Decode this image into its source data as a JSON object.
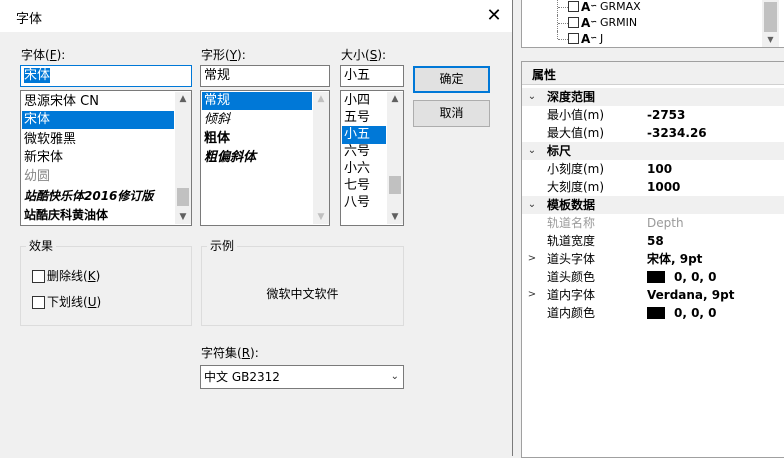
{
  "tree": {
    "items": [
      {
        "label": "GRMAX",
        "icon": "ruler-icon"
      },
      {
        "label": "GRMIN",
        "icon": "ruler-icon"
      },
      {
        "label": "J",
        "icon": "ruler-icon"
      }
    ]
  },
  "properties": {
    "title": "属性",
    "rows": [
      {
        "type": "category",
        "toggle": "⌄",
        "name": "深度范围"
      },
      {
        "type": "prop",
        "name": "最小值(m)",
        "value": "-2753"
      },
      {
        "type": "prop",
        "name": "最大值(m)",
        "value": "-3234.26"
      },
      {
        "type": "category",
        "toggle": "⌄",
        "name": "标尺"
      },
      {
        "type": "prop",
        "name": "小刻度(m)",
        "value": "100"
      },
      {
        "type": "prop",
        "name": "大刻度(m)",
        "value": "1000"
      },
      {
        "type": "category",
        "toggle": "⌄",
        "name": "模板数据"
      },
      {
        "type": "prop",
        "name": "轨道名称",
        "value": "Depth",
        "light": true
      },
      {
        "type": "prop",
        "name": "轨道宽度",
        "value": "58"
      },
      {
        "type": "prop",
        "toggle": ">",
        "name": "道头字体",
        "value": "宋体, 9pt"
      },
      {
        "type": "prop",
        "name": "道头颜色",
        "value": "0, 0, 0",
        "swatch": "#000000"
      },
      {
        "type": "prop",
        "toggle": ">",
        "name": "道内字体",
        "value": "Verdana, 9pt"
      },
      {
        "type": "prop",
        "name": "道内颜色",
        "value": "0, 0, 0",
        "swatch": "#000000"
      }
    ]
  },
  "dialog": {
    "title": "字体",
    "close": "✕",
    "font": {
      "label": "字体(",
      "hotkey": "F",
      "label_end": "):",
      "value": "宋体",
      "options": [
        "思源宋体 CN",
        "宋体",
        "微软雅黑",
        "新宋体",
        "幼圆",
        "站酷快乐体2016修订版",
        "站酷庆科黄油体"
      ],
      "selected": 1
    },
    "style": {
      "label": "字形(",
      "hotkey": "Y",
      "label_end": "):",
      "value": "常规",
      "options": [
        "常规",
        "倾斜",
        "粗体",
        "粗偏斜体"
      ],
      "selected": 0
    },
    "size": {
      "label": "大小(",
      "hotkey": "S",
      "label_end": "):",
      "value": "小五",
      "options": [
        "小四",
        "五号",
        "小五",
        "六号",
        "小六",
        "七号",
        "八号"
      ],
      "selected": 2
    },
    "ok": "确定",
    "cancel": "取消",
    "effects": {
      "label": "效果",
      "strike": {
        "text": "删除线(",
        "hotkey": "K",
        "end": ")",
        "checked": false
      },
      "underline": {
        "text": "下划线(",
        "hotkey": "U",
        "end": ")",
        "checked": false
      }
    },
    "sample": {
      "label": "示例",
      "text": "微软中文软件"
    },
    "charset": {
      "label": "字符集(",
      "hotkey": "R",
      "label_end": "):",
      "value": "中文 GB2312"
    }
  },
  "colors": {
    "accent": "#0078d7"
  }
}
